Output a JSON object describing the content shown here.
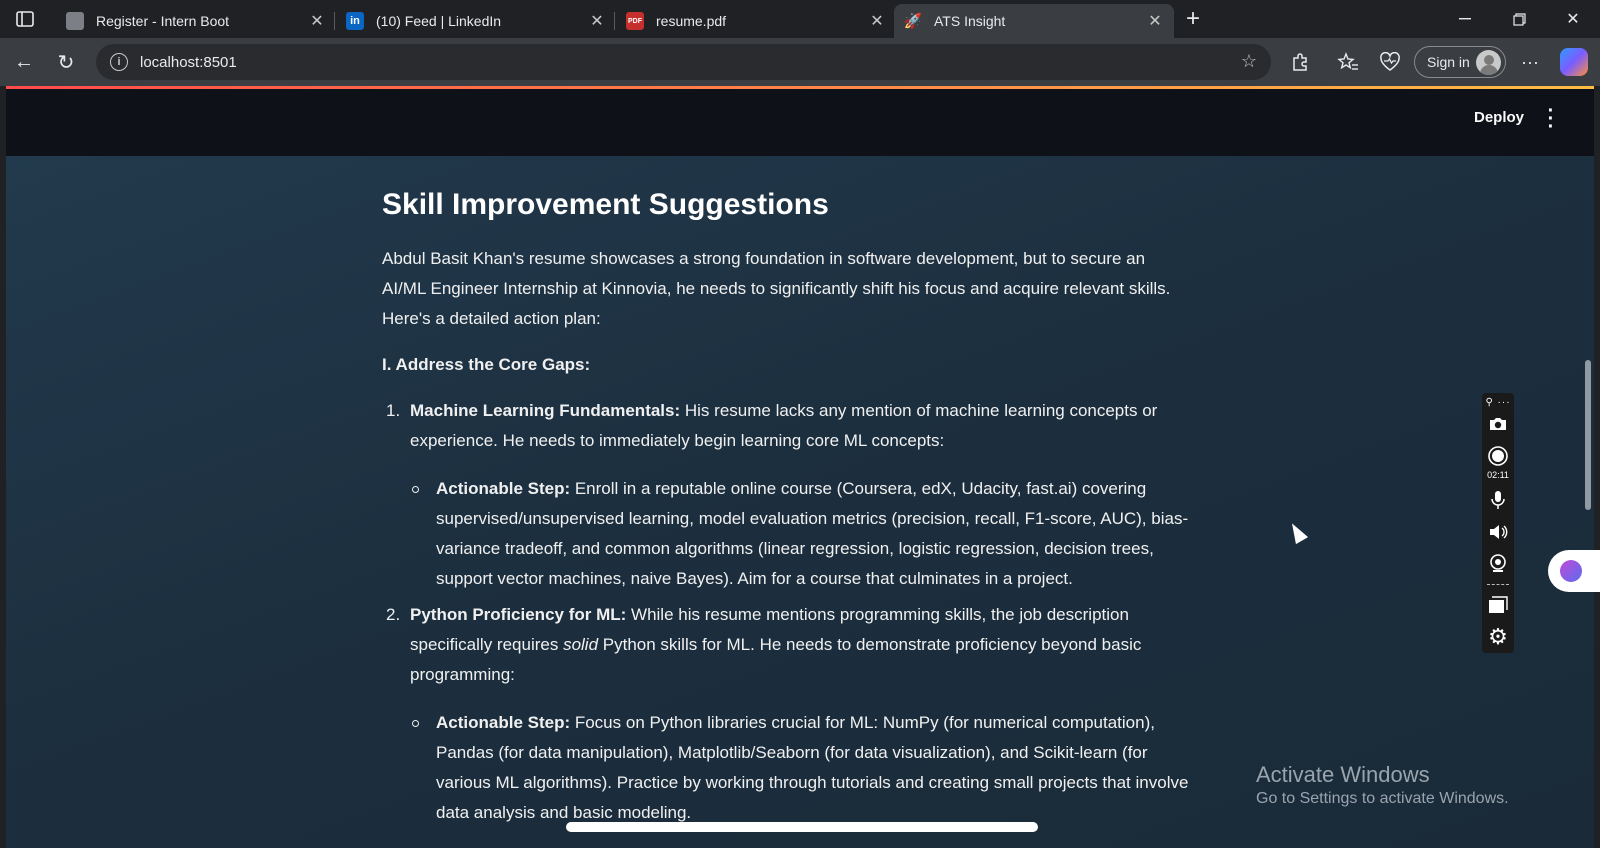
{
  "browser": {
    "tabs": [
      {
        "title": "Register - Intern Boot",
        "favicon": "document-icon",
        "active": false
      },
      {
        "title": "(10) Feed | LinkedIn",
        "favicon": "linkedin-icon",
        "active": false
      },
      {
        "title": "resume.pdf",
        "favicon": "pdf-icon",
        "active": false
      },
      {
        "title": "ATS Insight",
        "favicon": "rocket-icon",
        "active": true
      }
    ],
    "url": "localhost:8501",
    "signin_label": "Sign in"
  },
  "app": {
    "deploy_label": "Deploy"
  },
  "content": {
    "heading": "Skill Improvement Suggestions",
    "intro": "Abdul Basit Khan's resume showcases a strong foundation in software development, but to secure an AI/ML Engineer Internship at Kinnovia, he needs to significantly shift his focus and acquire relevant skills. Here's a detailed action plan:",
    "section_title": "I. Address the Core Gaps:",
    "items": [
      {
        "number": "1.",
        "title": "Machine Learning Fundamentals:",
        "text": " His resume lacks any mention of machine learning concepts or experience. He needs to immediately begin learning core ML concepts:",
        "step_label": "Actionable Step:",
        "step_text": " Enroll in a reputable online course (Coursera, edX, Udacity, fast.ai) covering supervised/unsupervised learning, model evaluation metrics (precision, recall, F1-score, AUC), bias-variance tradeoff, and common algorithms (linear regression, logistic regression, decision trees, support vector machines, naive Bayes). Aim for a course that culminates in a project."
      },
      {
        "number": "2.",
        "title": "Python Proficiency for ML:",
        "text_a": " While his resume mentions programming skills, the job description specifically requires ",
        "text_em": "solid",
        "text_b": " Python skills for ML. He needs to demonstrate proficiency beyond basic programming:",
        "step_label": "Actionable Step:",
        "step_text": " Focus on Python libraries crucial for ML: NumPy (for numerical computation), Pandas (for data manipulation), Matplotlib/Seaborn (for data visualization), and Scikit-learn (for various ML algorithms). Practice by working through tutorials and creating small projects that involve data analysis and basic modeling."
      }
    ]
  },
  "recorder": {
    "time": "02:11"
  },
  "watermark": {
    "line1": "Activate Windows",
    "line2": "Go to Settings to activate Windows."
  }
}
